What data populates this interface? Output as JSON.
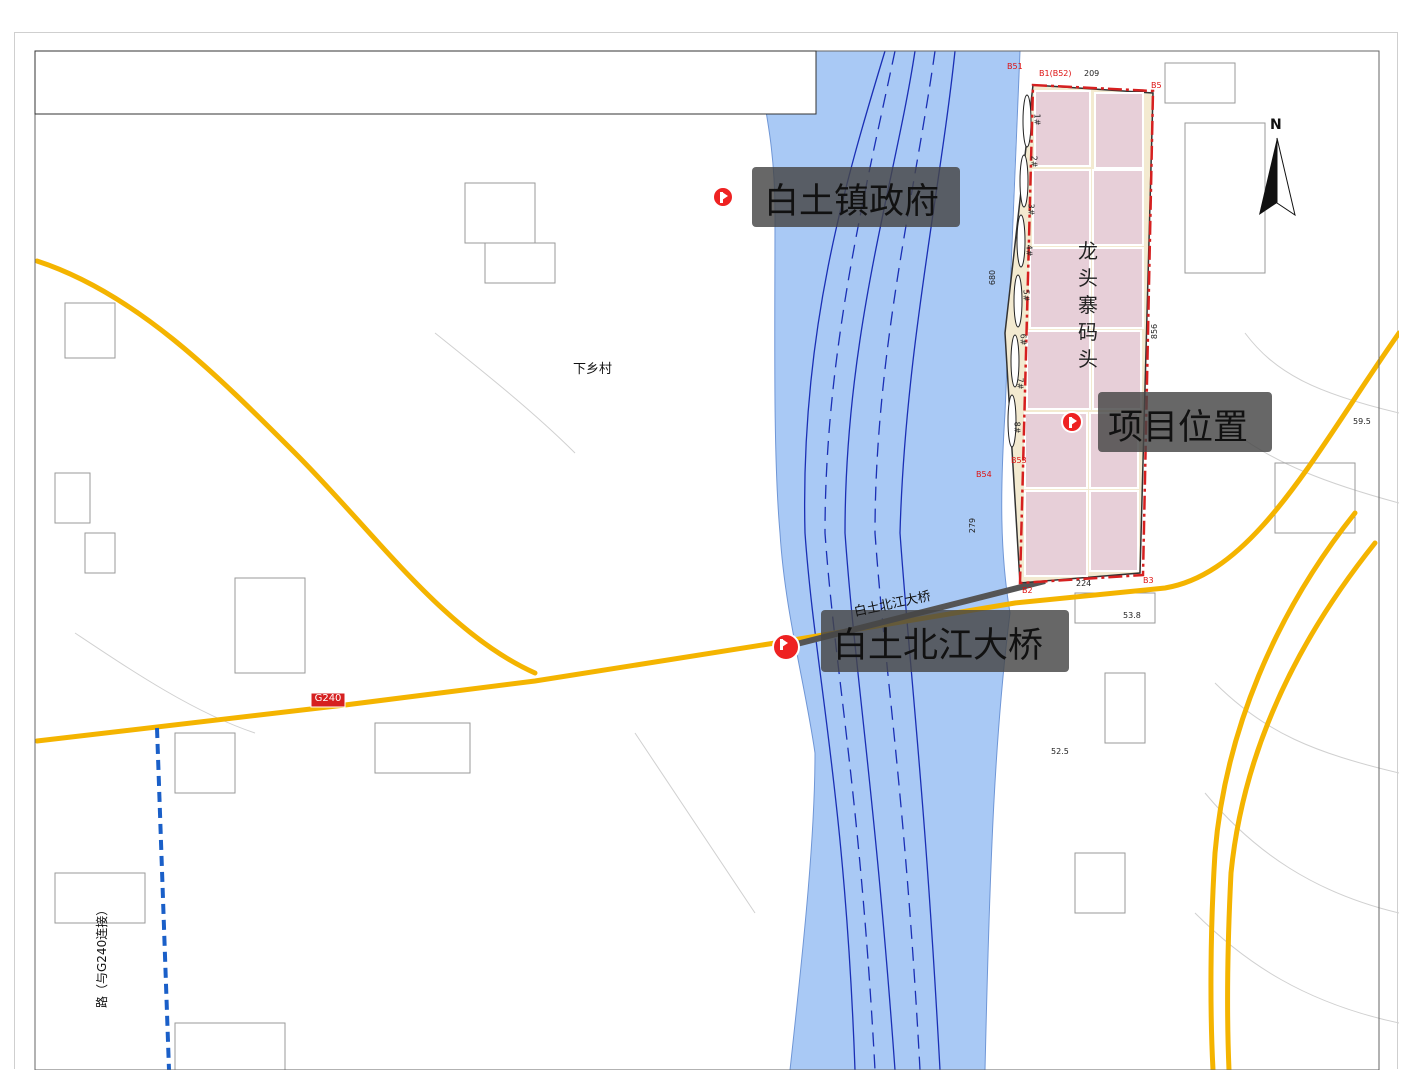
{
  "map": {
    "labels": {
      "gov": "白土镇政府",
      "project": "项目位置",
      "bridge_callout": "白土北江大桥",
      "bridge_small": "白土北江大桥",
      "village": "下乡村",
      "wharf": [
        "龙",
        "头",
        "寨",
        "码",
        "头"
      ],
      "highway": "G240",
      "north": "N",
      "vertical_road": "路（与G240连接）"
    },
    "dimensions": {
      "top": "209",
      "bottom": "224",
      "left_upper": "680",
      "left_lower": "279",
      "right": "856"
    },
    "boundary_points": [
      "B51",
      "B1(B52)",
      "B5",
      "B53",
      "B54",
      "B2",
      "B3"
    ],
    "berths": [
      "1#",
      "2#",
      "3#",
      "4#",
      "5#",
      "6#",
      "7#",
      "8#"
    ],
    "spot_heights": [
      "53.8",
      "52.5",
      "59.5"
    ],
    "colors": {
      "river": "#a9c9f5",
      "road": "#f4b400",
      "boundary": "#d62020",
      "wharf_fill": "#e7cfd8",
      "channel_line": "#1a2fb5",
      "callout_bg": "#505050",
      "flag": "#e22222"
    }
  }
}
